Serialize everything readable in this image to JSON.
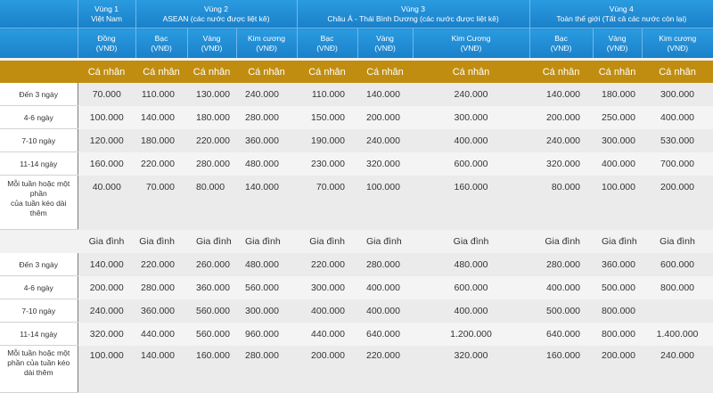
{
  "regions": [
    {
      "name": "Vùng 1",
      "sub": "Việt Nam"
    },
    {
      "name": "Vùng 2",
      "sub": "ASEAN (các nước được liệt kê)"
    },
    {
      "name": "Vùng 3",
      "sub": "Châu Á - Thái Bình Dương (các nước được liệt kê)"
    },
    {
      "name": "Vùng 4",
      "sub": "Toàn thế giới (Tất cả các nước còn lại)"
    }
  ],
  "tiers": [
    {
      "name": "Đồng",
      "unit": "(VNĐ)"
    },
    {
      "name": "Bạc",
      "unit": "(VNĐ)"
    },
    {
      "name": "Vàng",
      "unit": "(VNĐ)"
    },
    {
      "name": "Kim cương",
      "unit": "(VNĐ)"
    },
    {
      "name": "Bạc",
      "unit": "(VNĐ)"
    },
    {
      "name": "Vàng",
      "unit": "(VNĐ)"
    },
    {
      "name": "Kim Cương",
      "unit": "(VNĐ)"
    },
    {
      "name": "Bạc",
      "unit": "(VNĐ)"
    },
    {
      "name": "Vàng",
      "unit": "(VNĐ)"
    },
    {
      "name": "Kim cương",
      "unit": "(VNĐ)"
    }
  ],
  "individual": {
    "label": "Cá nhân",
    "rows": [
      {
        "label": "Đến 3 ngày",
        "values": [
          "70.000",
          "110.000",
          "130.000",
          "240.000",
          "110.000",
          "140.000",
          "240.000",
          "140.000",
          "180.000",
          "300.000"
        ]
      },
      {
        "label": "4-6 ngày",
        "values": [
          "100.000",
          "140.000",
          "180.000",
          "280.000",
          "150.000",
          "200.000",
          "300.000",
          "200.000",
          "250.000",
          "400.000"
        ]
      },
      {
        "label": "7-10 ngày",
        "values": [
          "120.000",
          "180.000",
          "220.000",
          "360.000",
          "190.000",
          "240.000",
          "400.000",
          "240.000",
          "300.000",
          "530.000"
        ]
      },
      {
        "label": "11-14 ngày",
        "values": [
          "160.000",
          "220.000",
          "280.000",
          "480.000",
          "230.000",
          "320.000",
          "600.000",
          "320.000",
          "400.000",
          "700.000"
        ]
      },
      {
        "label_lines": [
          "Mỗi tuần hoặc một",
          "phần",
          "của tuần kéo dài",
          "thêm"
        ],
        "values": [
          "40.000",
          "70.000",
          "80.000",
          "140.000",
          "70.000",
          "100.000",
          "160.000",
          "80.000",
          "100.000",
          "200.000"
        ]
      }
    ]
  },
  "family": {
    "label": "Gia đình",
    "rows": [
      {
        "label": "Đến 3 ngày",
        "values": [
          "140.000",
          "220.000",
          "260.000",
          "480.000",
          "220.000",
          "280.000",
          "480.000",
          "280.000",
          "360.000",
          "600.000"
        ]
      },
      {
        "label": "4-6 ngày",
        "values": [
          "200.000",
          "280.000",
          "360.000",
          "560.000",
          "300.000",
          "400.000",
          "600.000",
          "400.000",
          "500.000",
          "800.000"
        ]
      },
      {
        "label": "7-10 ngày",
        "values": [
          "240.000",
          "360.000",
          "560.000",
          "300.000",
          "400.000",
          "400.000",
          "400.000",
          "500.000",
          "800.000",
          ""
        ]
      },
      {
        "label": "11-14 ngày",
        "values": [
          "320.000",
          "440.000",
          "560.000",
          "960.000",
          "440.000",
          "640.000",
          "1.200.000",
          "640.000",
          "800.000",
          "1.400.000"
        ]
      },
      {
        "label_lines": [
          "Mỗi tuần hoặc một",
          "phần của tuần kéo",
          "dài thêm"
        ],
        "values": [
          "100.000",
          "140.000",
          "160.000",
          "280.000",
          "200.000",
          "220.000",
          "320.000",
          "160.000",
          "200.000",
          "240.000"
        ]
      }
    ]
  }
}
